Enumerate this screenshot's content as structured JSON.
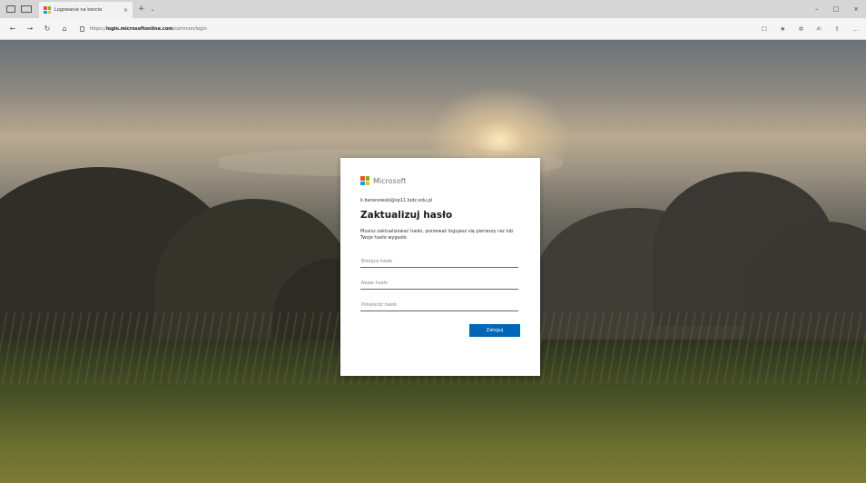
{
  "browser": {
    "tab_title": "Logowanie na koncie",
    "tab_close": "×",
    "new_tab": "+",
    "tab_dropdown": "⌄",
    "window_controls": [
      "–",
      "□",
      "×"
    ],
    "url_prefix": "https://",
    "url_host": "login.microsoftonline.com",
    "url_path": "/common/login",
    "nav": {
      "back": "←",
      "forward": "→",
      "refresh": "↻",
      "home": "⌂"
    },
    "toolbar_right": [
      "☐",
      "★",
      "✲",
      "✍",
      "⇪",
      "…"
    ]
  },
  "login": {
    "brand": "Microsoft",
    "account": "k.baranowski@sp11.lodz.edu.pl",
    "title": "Zaktualizuj hasło",
    "description": "Musisz zaktualizować hasło, ponieważ logujesz się pierwszy raz lub Twoje hasło wygasło.",
    "current_password_placeholder": "Bieżące hasło",
    "new_password_placeholder": "Nowe hasło",
    "confirm_password_placeholder": "Potwierdź hasło",
    "submit_label": "Zaloguj"
  },
  "colors": {
    "accent": "#0067b8",
    "logo_red": "#f25022",
    "logo_green": "#7fba00",
    "logo_blue": "#00a4ef",
    "logo_yellow": "#ffb900"
  },
  "icons": {
    "back": "back-arrow-icon",
    "forward": "forward-arrow-icon",
    "refresh": "refresh-icon",
    "home": "home-icon",
    "lock": "lock-icon",
    "favorite": "star-icon"
  }
}
